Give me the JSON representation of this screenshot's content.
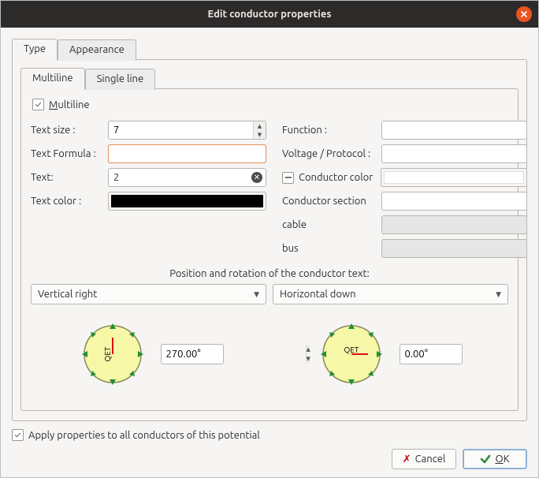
{
  "window": {
    "title": "Edit conductor properties"
  },
  "tabs": {
    "type": "Type",
    "appearance": "Appearance"
  },
  "subtabs": {
    "multiline": "Multiline",
    "singleline": "Single line"
  },
  "multiline": {
    "checkbox_label": "Multiline",
    "text_size_label": "Text size :",
    "text_size_value": "7",
    "text_formula_label": "Text Formula :",
    "text_formula_value": "",
    "text_label": "Text:",
    "text_value": "2",
    "text_color_label": "Text color :",
    "text_color_value": "#000000",
    "function_label": "Function :",
    "function_value": "",
    "voltage_label": "Voltage / Protocol :",
    "voltage_value": "",
    "conductor_color_label": "Conductor color",
    "conductor_color_value": "#ffffff",
    "conductor_section_label": "Conductor section",
    "conductor_section_value": "",
    "cable_label": "cable",
    "cable_value": "",
    "bus_label": "bus",
    "bus_value": ""
  },
  "rotation": {
    "title": "Position and rotation of the conductor text:",
    "vertical_combo": "Vertical right",
    "horizontal_combo": "Horizontal down",
    "left_angle": "270.00°",
    "right_angle": "0.00°",
    "dial_label": "QET"
  },
  "footer": {
    "apply_all_label": "Apply properties to all conductors of this potential",
    "cancel": "Cancel",
    "ok": "OK"
  }
}
